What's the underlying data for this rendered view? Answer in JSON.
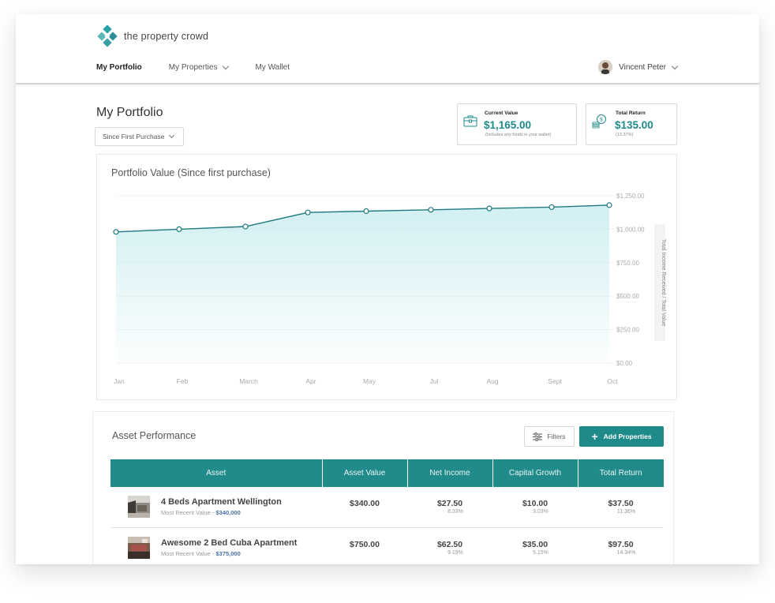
{
  "brand": {
    "name": "the property crowd",
    "accent": "#1f8a8a"
  },
  "nav": {
    "items": [
      {
        "label": "My Portfolio",
        "active": true,
        "dropdown": false
      },
      {
        "label": "My Properties",
        "active": false,
        "dropdown": true
      },
      {
        "label": "My Wallet",
        "active": false,
        "dropdown": false
      }
    ],
    "user_name": "Vincent Peter"
  },
  "page": {
    "title": "My Portfolio",
    "period_select": "Since First Purchase"
  },
  "stats": {
    "current_value": {
      "label": "Current Value",
      "value": "$1,165.00",
      "note": "(Includes any funds in your wallet)",
      "icon": "briefcase-icon"
    },
    "total_return": {
      "label": "Total Return",
      "value": "$135.00",
      "note": "(13.37%)",
      "icon": "coins-icon"
    }
  },
  "chart": {
    "title": "Portfolio Value (Since first purchase)",
    "y_axis_side_label": "Total Income Received / Total Value"
  },
  "chart_data": {
    "type": "area",
    "title": "Portfolio Value (Since first purchase)",
    "categories": [
      "Jan",
      "Feb",
      "March",
      "Apr",
      "May",
      "Jul",
      "Aug",
      "Sept",
      "Oct"
    ],
    "series": [
      {
        "values": [
          980,
          1000,
          1020,
          1125,
          1135,
          1145,
          1155,
          1165,
          1180
        ]
      }
    ],
    "y_ticks": [
      "$1,250.00",
      "$1,000.00",
      "$750.00",
      "$500.00",
      "$250.00",
      "$0.00"
    ],
    "ylim": [
      0,
      1250
    ],
    "ylabel": "Total Income Received / Total Value",
    "grid": true,
    "line_color": "#1f7a80",
    "fill_color": "#c9ecef"
  },
  "assets": {
    "title": "Asset Performance",
    "filters_label": "Filters",
    "add_label": "Add Properties",
    "columns": [
      "Asset",
      "Asset Value",
      "Net Income",
      "Capital Growth",
      "Total Return"
    ],
    "rows": [
      {
        "name": "4 Beds Apartment Wellington",
        "sub_label": "Most Recent Value -",
        "sub_value": "$340,000",
        "asset_value": "$340.00",
        "net_income": "$27.50",
        "net_income_pct": "8.33%",
        "capital_growth": "$10.00",
        "capital_growth_pct": "3.03%",
        "total_return": "$37.50",
        "total_return_pct": "11.36%"
      },
      {
        "name": "Awesome 2 Bed Cuba Apartment",
        "sub_label": "Most Recent Value -",
        "sub_value": "$375,000",
        "asset_value": "$750.00",
        "net_income": "$62.50",
        "net_income_pct": "9.19%",
        "capital_growth": "$35.00",
        "capital_growth_pct": "5.15%",
        "total_return": "$97.50",
        "total_return_pct": "14.34%"
      }
    ]
  }
}
